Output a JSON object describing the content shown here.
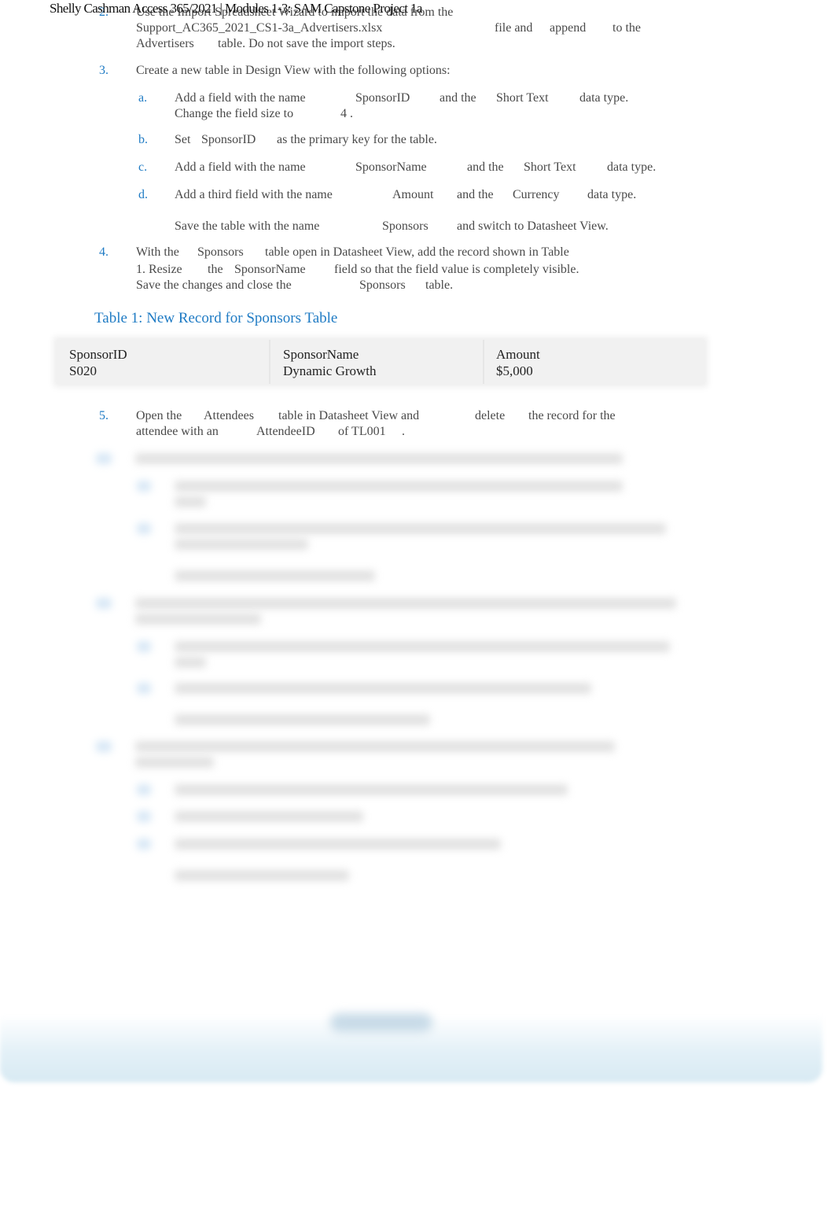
{
  "header": {
    "title": "Shelly Cashman Access 365/2021 | Modules 1-3: SAM Capstone Project 1a"
  },
  "steps": [
    {
      "num": "2.",
      "lines": [
        [
          "Use the Import Spreadsheet Wizard to import the data from the"
        ],
        [
          "Support_AC365_2021_CS1-3a_Advertisers.xlsx",
          "file and",
          "append",
          "to the"
        ],
        [
          "Advertisers",
          "table. Do not save the import steps."
        ]
      ]
    },
    {
      "num": "3.",
      "lines": [
        [
          "Create a new table in Design View with the following options:"
        ]
      ],
      "substeps": [
        {
          "num": "a.",
          "lines": [
            [
              "Add a field with the name",
              "SponsorID",
              "and the",
              "Short Text",
              "data type."
            ],
            [
              "Change the field size to",
              "4 ."
            ]
          ]
        },
        {
          "num": "b.",
          "lines": [
            [
              "Set",
              "SponsorID",
              "as the primary key for the table."
            ]
          ]
        },
        {
          "num": "c.",
          "lines": [
            [
              "Add a field with the name",
              "SponsorName",
              "and the",
              "Short Text",
              "data type."
            ]
          ]
        },
        {
          "num": "d.",
          "lines": [
            [
              "Add a third field with the name",
              "Amount",
              "and the",
              "Currency",
              "data type."
            ]
          ]
        }
      ],
      "closing": [
        "Save the table with the name",
        "Sponsors",
        "and switch to Datasheet View."
      ]
    },
    {
      "num": "4.",
      "lines": [
        [
          "With the",
          "Sponsors",
          "table open in Datasheet View, add the record shown in Table"
        ],
        [
          "1.  Resize",
          "the",
          "SponsorName",
          "field so that the field value is completely visible."
        ],
        [
          "Save the changes and close the",
          "Sponsors",
          "table."
        ]
      ]
    },
    {
      "num": "5.",
      "lines": [
        [
          "Open the",
          "Attendees",
          "table in Datasheet View and",
          "delete",
          "the record for the"
        ],
        [
          "attendee with an",
          "AttendeeID",
          "of  TL001",
          ". "
        ]
      ]
    }
  ],
  "table": {
    "caption": "Table 1: New Record for Sponsors Table",
    "headers": [
      "SponsorID",
      "SponsorName",
      "Amount"
    ],
    "row": [
      "S020",
      "Dynamic Growth",
      "$5,000"
    ]
  },
  "colors": {
    "accent": "#1f7bc4",
    "text": "#4a4a4a"
  }
}
